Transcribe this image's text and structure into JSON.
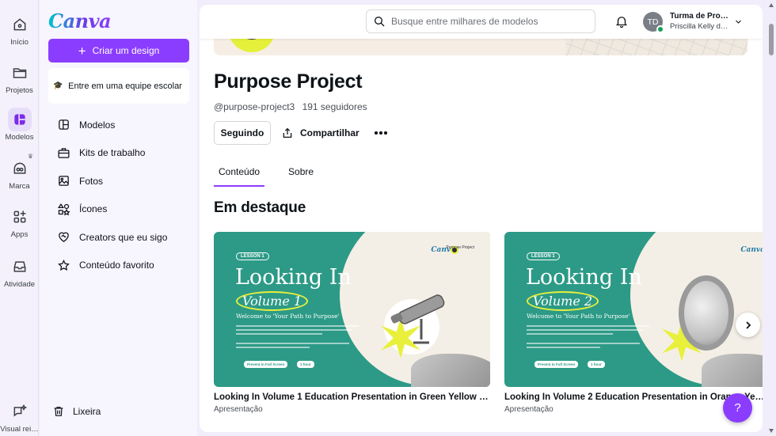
{
  "rail": {
    "items": [
      {
        "label": "Início",
        "icon": "home-icon"
      },
      {
        "label": "Projetos",
        "icon": "folder-icon"
      },
      {
        "label": "Modelos",
        "icon": "templates-icon",
        "active": true
      },
      {
        "label": "Marca",
        "icon": "brand-icon"
      },
      {
        "label": "Apps",
        "icon": "apps-icon"
      },
      {
        "label": "Atividade",
        "icon": "inbox-icon"
      },
      {
        "label": "Visual rei…",
        "icon": "sparkle-chat-icon"
      }
    ]
  },
  "panel": {
    "logo": "Canva",
    "create_label": "Criar um design",
    "team_card": "Entre em uma equipe escolar",
    "nav": [
      {
        "label": "Modelos",
        "icon": "layout-icon"
      },
      {
        "label": "Kits de trabalho",
        "icon": "briefcase-icon"
      },
      {
        "label": "Fotos",
        "icon": "image-icon"
      },
      {
        "label": "Ícones",
        "icon": "shapes-icon"
      },
      {
        "label": "Creators que eu sigo",
        "icon": "heart-handshake-icon"
      },
      {
        "label": "Conteúdo favorito",
        "icon": "star-icon"
      }
    ],
    "trash_label": "Lixeira"
  },
  "topbar": {
    "search_placeholder": "Busque entre milhares de modelos",
    "avatar_initials": "TD",
    "account_name": "Turma de Prof…",
    "account_sub": "Priscilla Kelly d…"
  },
  "profile": {
    "name": "Purpose Project",
    "handle": "@purpose-project3",
    "followers": "191 seguidores",
    "following_label": "Seguindo",
    "share_label": "Compartilhar",
    "tabs": [
      {
        "label": "Conteúdo",
        "active": true
      },
      {
        "label": "Sobre",
        "active": false
      }
    ],
    "featured_title": "Em destaque"
  },
  "cards": [
    {
      "title": "Looking In Volume 1 Education Presentation in Green Yellow Ligh…",
      "type": "Apresentação",
      "thumb": {
        "lesson": "LESSON 1",
        "heading": "Looking In",
        "volume": "Volume 1",
        "welcome": "Welcome to 'Your Path to Purpose'",
        "brand": "Canva",
        "partner": "Purpose Project",
        "pill1": "Present in Full Screen",
        "pill2": "1 hour"
      }
    },
    {
      "title": "Looking In Volume 2 Education Presentation in Orange Ye…",
      "type": "Apresentação",
      "thumb": {
        "lesson": "LESSON 1",
        "heading": "Looking In",
        "volume": "Volume 2",
        "welcome": "Welcome to 'Your Path to Purpose'",
        "brand": "Canva",
        "partner": "",
        "pill1": "Present in Full Screen",
        "pill2": "1 hour"
      }
    }
  ],
  "help_label": "?",
  "colors": {
    "accent": "#8b3dff",
    "teal": "#2c9a86",
    "yellow": "#e8f03c"
  }
}
